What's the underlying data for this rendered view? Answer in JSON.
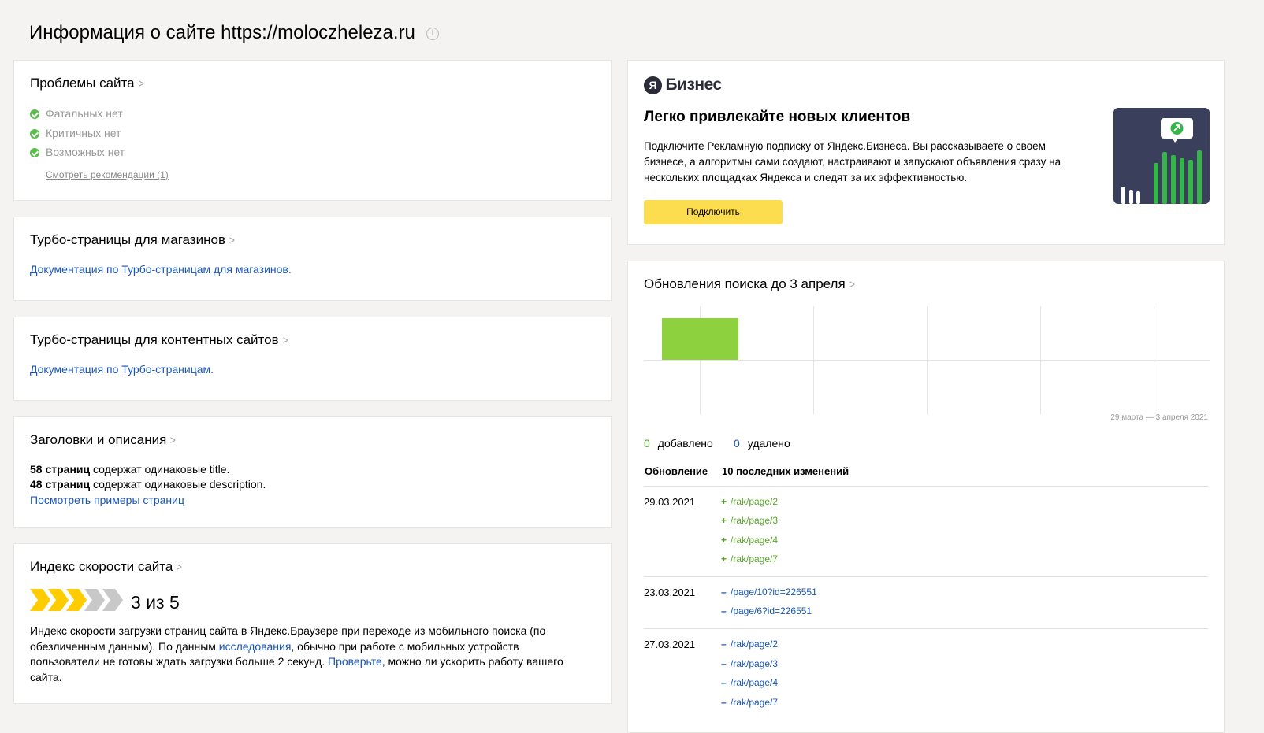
{
  "page": {
    "title": "Информация о сайте https://moloczheleza.ru",
    "info_icon": "i"
  },
  "problems": {
    "title": "Проблемы сайта",
    "items": [
      "Фатальных нет",
      "Критичных нет",
      "Возможных нет"
    ],
    "link": "Смотреть рекомендации (1)"
  },
  "turbo_shops": {
    "title": "Турбо-страницы для магазинов",
    "link": "Документация по Турбо-страницам для магазинов."
  },
  "turbo_content": {
    "title": "Турбо-страницы для контентных сайтов",
    "link": "Документация по Турбо-страницам."
  },
  "headers": {
    "title": "Заголовки и описания",
    "line1_bold": "58 страниц",
    "line1_rest": " содержат одинаковые title.",
    "line2_bold": "48 страниц",
    "line2_rest": " содержат одинаковые description.",
    "link": "Посмотреть примеры страниц"
  },
  "speed": {
    "title": "Индекс скорости сайта",
    "score": 3,
    "max": 5,
    "score_text": "3 из 5",
    "desc_1": "Индекс скорости загрузки страниц сайта в Яндекс.Браузере при переходе из мобильного поиска (по обезличенным данным). По данным ",
    "desc_link1": "исследования",
    "desc_2": ", обычно при работе с мобильных устройств пользователи не готовы ждать загрузки больше 2 секунд. ",
    "desc_link2": "Проверьте",
    "desc_3": ", можно ли ускорить работу вашего сайта."
  },
  "ad": {
    "logo_letter": "Я",
    "logo_text": "Бизнес",
    "title": "Легко привлекайте новых клиентов",
    "text": "Подключите Рекламную подписку от Яндекс.Бизнеса. Вы рассказываете о своем бизнесе, а алгоритмы сами создают, настраивают и запускают объявления сразу на нескольких площадках Яндекса и следят за их эффективностью.",
    "button": "Подключить",
    "colors": {
      "button": "#fddd50",
      "illustration_bg": "#3a3f5c",
      "bar_green": "#35b54a"
    }
  },
  "updates": {
    "title": "Обновления поиска до 3 апреля",
    "date_range": "29 марта — 3 апреля 2021",
    "added_count": "0",
    "added_label": "добавлено",
    "removed_count": "0",
    "removed_label": "удалено",
    "col_update": "Обновление",
    "col_changes": "10 последних изменений",
    "rows": [
      {
        "date": "29.03.2021",
        "changes": [
          {
            "sign": "+",
            "path": "/rak/page/2"
          },
          {
            "sign": "+",
            "path": "/rak/page/3"
          },
          {
            "sign": "+",
            "path": "/rak/page/4"
          },
          {
            "sign": "+",
            "path": "/rak/page/7"
          }
        ]
      },
      {
        "date": "23.03.2021",
        "changes": [
          {
            "sign": "–",
            "path": "/page/10?id=226551"
          },
          {
            "sign": "–",
            "path": "/page/6?id=226551"
          }
        ]
      },
      {
        "date": "27.03.2021",
        "changes": [
          {
            "sign": "–",
            "path": "/rak/page/2"
          },
          {
            "sign": "–",
            "path": "/rak/page/3"
          },
          {
            "sign": "–",
            "path": "/rak/page/4"
          },
          {
            "sign": "–",
            "path": "/rak/page/7"
          }
        ]
      }
    ],
    "colors": {
      "bar": "#8dd13f",
      "added": "#5ba52a",
      "removed": "#1a55b8"
    }
  }
}
